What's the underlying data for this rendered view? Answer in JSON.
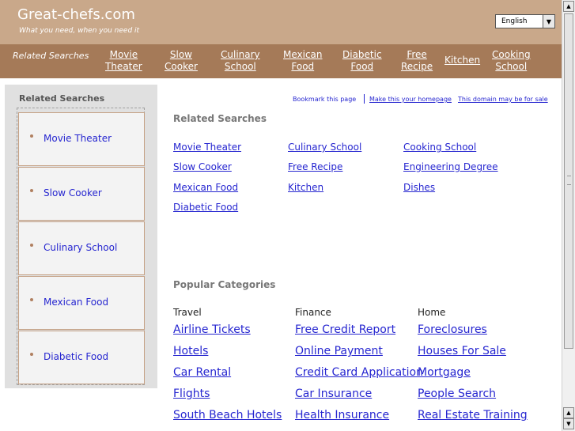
{
  "header": {
    "site_title": "Great-chefs.com",
    "tagline": "What you need, when you need it",
    "language": "English"
  },
  "nav": {
    "title": "Related Searches",
    "links": [
      "Movie\nTheater",
      "Slow\nCooker",
      "Culinary\nSchool",
      "Mexican\nFood",
      "Diabetic\nFood",
      "Free\nRecipe",
      "Kitchen",
      "Cooking\nSchool"
    ]
  },
  "sidebar": {
    "title": "Related Searches",
    "items": [
      "Movie Theater",
      "Slow Cooker",
      "Culinary School",
      "Mexican Food",
      "Diabetic Food"
    ]
  },
  "toplinks": {
    "bookmark": "Bookmark this page",
    "homepage": "Make this your homepage",
    "sale": "This domain may be for sale"
  },
  "related": {
    "heading": "Related Searches",
    "col1": [
      "Movie Theater",
      "Slow Cooker",
      "Mexican Food",
      "Diabetic Food"
    ],
    "col2": [
      "Culinary School",
      "Free Recipe",
      "Kitchen"
    ],
    "col3": [
      "Cooking School",
      "Engineering Degree",
      "Dishes"
    ]
  },
  "popular": {
    "heading": "Popular Categories",
    "categories": [
      {
        "title": "Travel",
        "links": [
          "Airline Tickets",
          "Hotels",
          "Car Rental",
          "Flights",
          "South Beach Hotels"
        ]
      },
      {
        "title": "Finance",
        "links": [
          "Free Credit Report",
          "Online Payment",
          "Credit Card Application",
          "Car Insurance",
          "Health Insurance"
        ]
      },
      {
        "title": "Home",
        "links": [
          "Foreclosures",
          "Houses For Sale",
          "Mortgage",
          "People Search",
          "Real Estate Training"
        ]
      }
    ]
  },
  "colors": {
    "header_bg": "#c9a88a",
    "nav_bg": "#a57a58",
    "link": "#2626d0"
  }
}
